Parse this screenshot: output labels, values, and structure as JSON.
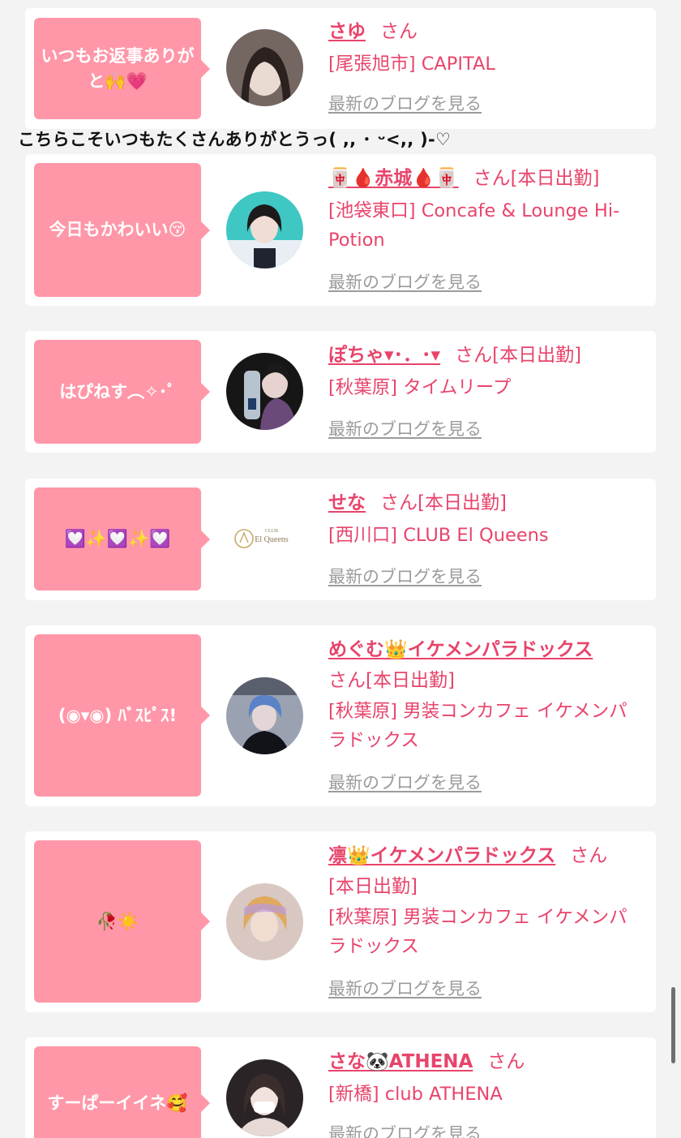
{
  "reply_text": "こちらこそいつもたくさんありがとうっ(  ,, ･ ᵕ<,, )-♡",
  "blog_link_label": "最新のブログを見る",
  "san_label": "さん",
  "cards": [
    {
      "bubble": "いつもお返事ありがと🙌💗",
      "name": "さゆ",
      "suffix": "さん",
      "shop": "[尾張旭市] CAPITAL",
      "avatar": "avatar-photo"
    },
    {
      "bubble": "今日もかわいい😚",
      "name": "🀄🩸赤城🩸🀄",
      "suffix": "さん[本日出勤]",
      "shop": "[池袋東口] Concafe & Lounge Hi-Potion",
      "avatar": "avatar-photo"
    },
    {
      "bubble": "はぴねす︵✧･ﾟ",
      "name": "ぽちゃ▾･．･▾",
      "suffix": "さん[本日出勤]",
      "shop": "[秋葉原] タイムリープ",
      "avatar": "avatar-photo"
    },
    {
      "bubble": "💟✨💟✨💟",
      "name": "せな",
      "suffix": "さん[本日出勤]",
      "shop": "[西川口] CLUB El Queens",
      "avatar": "club-logo",
      "logo_small": "CLUB",
      "logo_text": "El Queens"
    },
    {
      "bubble": "(◉▾◉) ﾊﾞｽﾋﾟｽ!",
      "name": "めぐむ👑イケメンパラドックス",
      "suffix": "さん[本日出勤]",
      "shop": "[秋葉原] 男装コンカフェ イケメンパラドックス",
      "avatar": "avatar-photo"
    },
    {
      "bubble": "🥀☀️",
      "name": "凛👑イケメンパラドックス",
      "suffix": "さん",
      "suffix2": "[本日出勤]",
      "shop": "[秋葉原] 男装コンカフェ イケメンパラドックス",
      "avatar": "avatar-photo"
    },
    {
      "bubble": "すーぱーイイネ🥰",
      "name": "さな🐼ATHENA",
      "suffix": "さん",
      "shop": "[新橋] club ATHENA",
      "avatar": "avatar-photo"
    }
  ],
  "colors": {
    "bubble": "#ff97a8",
    "accent": "#e8446b",
    "link_gray": "#9b9b9b",
    "background": "#f3f3f3"
  }
}
